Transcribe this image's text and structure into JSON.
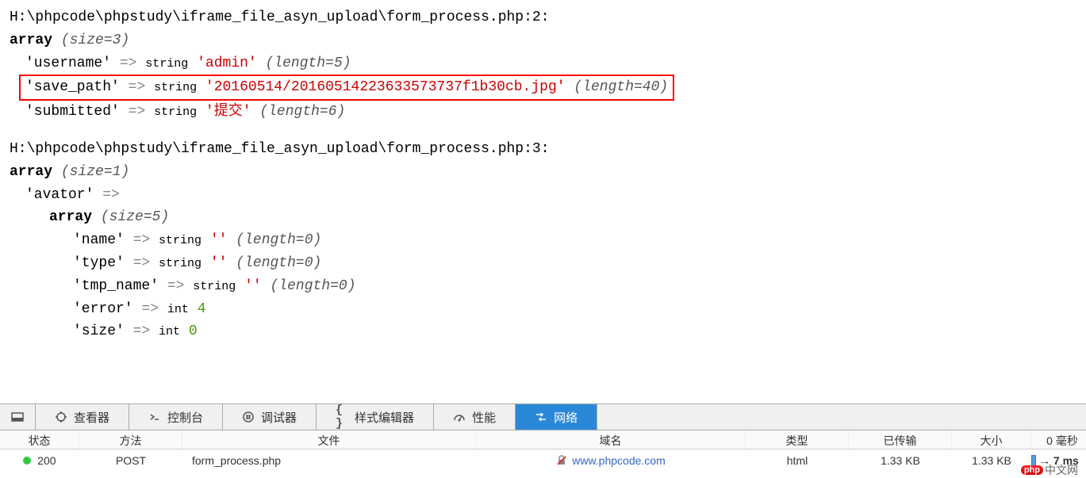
{
  "dump1": {
    "path": "H:\\phpcode\\phpstudy\\iframe_file_asyn_upload\\form_process.php:2:",
    "array_label": "array",
    "size_label": "(size=3)",
    "items": [
      {
        "key": "'username'",
        "arrow": "=>",
        "type": "string",
        "value": "'admin'",
        "length": "(length=5)"
      },
      {
        "key": "'save_path'",
        "arrow": "=>",
        "type": "string",
        "value": "'20160514/20160514223633573737f1b30cb.jpg'",
        "length": "(length=40)",
        "highlighted": true
      },
      {
        "key": "'submitted'",
        "arrow": "=>",
        "type": "string",
        "value": "'提交'",
        "length": "(length=6)"
      }
    ]
  },
  "dump2": {
    "path": "H:\\phpcode\\phpstudy\\iframe_file_asyn_upload\\form_process.php:3:",
    "array_label": "array",
    "size_label": "(size=1)",
    "key": "'avator'",
    "arrow": "=>",
    "inner_array_label": "array",
    "inner_size_label": "(size=5)",
    "items": [
      {
        "key": "'name'",
        "arrow": "=>",
        "type": "string",
        "value": "''",
        "length": "(length=0)"
      },
      {
        "key": "'type'",
        "arrow": "=>",
        "type": "string",
        "value": "''",
        "length": "(length=0)"
      },
      {
        "key": "'tmp_name'",
        "arrow": "=>",
        "type": "string",
        "value": "''",
        "length": "(length=0)"
      },
      {
        "key": "'error'",
        "arrow": "=>",
        "type": "int",
        "intval": "4"
      },
      {
        "key": "'size'",
        "arrow": "=>",
        "type": "int",
        "intval": "0"
      }
    ]
  },
  "toolbar": {
    "inspector": "查看器",
    "console": "控制台",
    "debugger": "调试器",
    "style": "样式编辑器",
    "performance": "性能",
    "network": "网络"
  },
  "table": {
    "headers": {
      "status": "状态",
      "method": "方法",
      "file": "文件",
      "domain": "域名",
      "type": "类型",
      "transferred": "已传输",
      "size": "大小",
      "zero_ms": "0 毫秒"
    },
    "row": {
      "status": "200",
      "method": "POST",
      "file": "form_process.php",
      "domain": "www.phpcode.com",
      "type": "html",
      "transferred": "1.33 KB",
      "size": "1.33 KB",
      "timing": "→ 7 ms"
    }
  },
  "watermark": {
    "logo": "php",
    "text": "中文网"
  }
}
